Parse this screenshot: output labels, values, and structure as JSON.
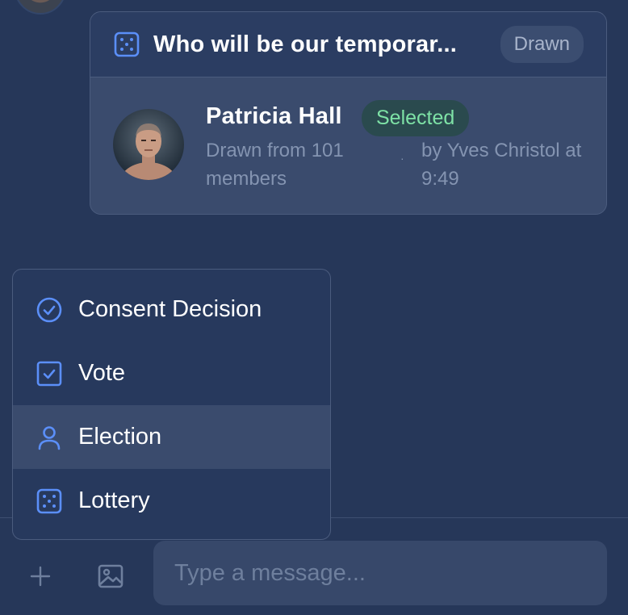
{
  "lottery_card": {
    "title": "Who will be our temporar...",
    "status_badge": "Drawn",
    "winner_name": "Patricia Hall",
    "winner_badge": "Selected",
    "drawn_from": "Drawn from 101 members",
    "separator": "·",
    "drawn_by": "by Yves Christol at 9:49"
  },
  "menu": {
    "items": [
      {
        "label": "Consent Decision",
        "icon": "check-circle-icon"
      },
      {
        "label": "Vote",
        "icon": "checkbox-icon"
      },
      {
        "label": "Election",
        "icon": "person-icon"
      },
      {
        "label": "Lottery",
        "icon": "dice-icon"
      }
    ],
    "hovered_index": 2
  },
  "composer": {
    "placeholder": "Type a message..."
  },
  "colors": {
    "background": "#263759",
    "accent": "#5b8ff9",
    "selected_green": "#7ee2a6",
    "muted_text": "#8494b1"
  }
}
